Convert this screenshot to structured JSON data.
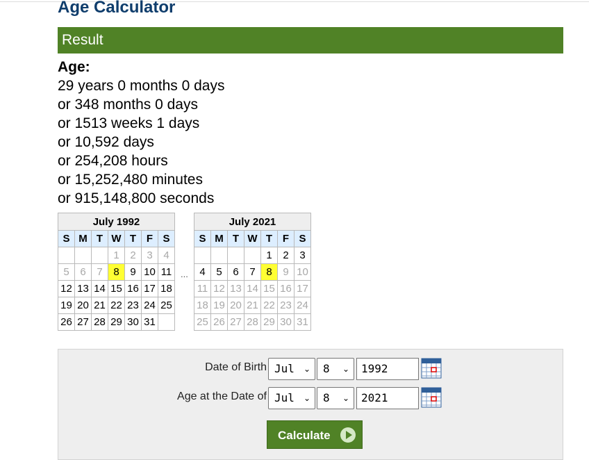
{
  "page": {
    "title": "Age Calculator"
  },
  "result": {
    "header": "Result",
    "age_label": "Age:",
    "lines": [
      "29 years 0 months 0 days",
      "or 348 months 0 days",
      "or 1513 weeks 1 days",
      "or 10,592 days",
      "or 254,208 hours",
      "or 15,252,480 minutes",
      "or 915,148,800 seconds"
    ]
  },
  "calendars": [
    {
      "title": "July 1992",
      "days_of_week": [
        "S",
        "M",
        "T",
        "W",
        "T",
        "F",
        "S"
      ],
      "weeks": [
        [
          "",
          "",
          "",
          "1",
          "2",
          "3",
          "4"
        ],
        [
          "5",
          "6",
          "7",
          "8",
          "9",
          "10",
          "11"
        ],
        [
          "12",
          "13",
          "14",
          "15",
          "16",
          "17",
          "18"
        ],
        [
          "19",
          "20",
          "21",
          "22",
          "23",
          "24",
          "25"
        ],
        [
          "26",
          "27",
          "28",
          "29",
          "30",
          "31",
          ""
        ]
      ],
      "highlighted_day": "8",
      "dimmed_through_day": "7",
      "dimmed_from_day": "32"
    },
    {
      "title": "July 2021",
      "days_of_week": [
        "S",
        "M",
        "T",
        "W",
        "T",
        "F",
        "S"
      ],
      "weeks": [
        [
          "",
          "",
          "",
          "",
          "1",
          "2",
          "3"
        ],
        [
          "4",
          "5",
          "6",
          "7",
          "8",
          "9",
          "10"
        ],
        [
          "11",
          "12",
          "13",
          "14",
          "15",
          "16",
          "17"
        ],
        [
          "18",
          "19",
          "20",
          "21",
          "22",
          "23",
          "24"
        ],
        [
          "25",
          "26",
          "27",
          "28",
          "29",
          "30",
          "31"
        ]
      ],
      "highlighted_day": "8",
      "dimmed_through_day": "0",
      "dimmed_from_day": "9"
    }
  ],
  "between_calendars": "...",
  "form": {
    "dob_label": "Date of Birth",
    "dob_month": "Jul",
    "dob_day": "8",
    "dob_year": "1992",
    "at_label": "Age at the Date of",
    "at_month": "Jul",
    "at_day": "8",
    "at_year": "2021",
    "calculate_label": "Calculate"
  },
  "icons": {
    "dropdown": "chevron-down-icon",
    "calendar": "calendar-icon",
    "calculate": "play-circle-icon"
  },
  "colors": {
    "title": "#0f3d6c",
    "result_bar": "#508226",
    "button": "#508226",
    "highlight": "#ffff33",
    "dow_bg": "#ddeeff"
  }
}
